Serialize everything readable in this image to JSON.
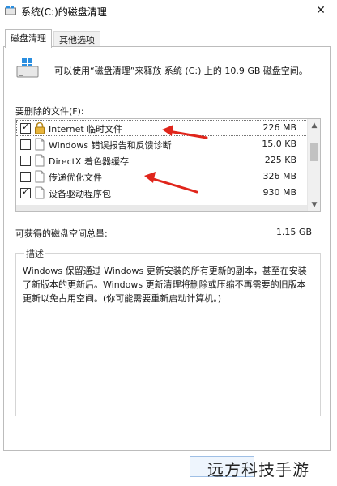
{
  "window": {
    "title": "系统(C:)的磁盘清理",
    "close_glyph": "✕"
  },
  "tabs": [
    {
      "label": "磁盘清理",
      "active": true
    },
    {
      "label": "其他选项",
      "active": false
    }
  ],
  "intro": {
    "text": "可以使用“磁盘清理”来释放 系统 (C:) 上的 10.9 GB 磁盘空间。",
    "icon": "drive-cleanup-icon"
  },
  "files": {
    "label": "要删除的文件(F):",
    "items": [
      {
        "name": "Internet 临时文件",
        "size": "226 MB",
        "checked": true,
        "icon": "lock-icon"
      },
      {
        "name": "Windows 错误报告和反馈诊断",
        "size": "15.0 KB",
        "checked": false,
        "icon": "blank-file-icon"
      },
      {
        "name": "DirectX 着色器缓存",
        "size": "225 KB",
        "checked": false,
        "icon": "blank-file-icon"
      },
      {
        "name": "传递优化文件",
        "size": "326 MB",
        "checked": false,
        "icon": "blank-file-icon"
      },
      {
        "name": "设备驱动程序包",
        "size": "930 MB",
        "checked": true,
        "icon": "blank-file-icon"
      }
    ]
  },
  "total": {
    "label": "可获得的磁盘空间总量:",
    "value": "1.15 GB"
  },
  "description": {
    "title": "描述",
    "text": "Windows 保留通过 Windows 更新安装的所有更新的副本，甚至在安装了新版本的更新后。Windows 更新清理将删除或压缩不再需要的旧版本更新以免占用空间。(你可能需要重新启动计算机。)"
  },
  "watermark": "远方科技手游",
  "colors": {
    "annotation_arrow": "#e0251b",
    "drive_icon_blue": "#2a8ee0"
  }
}
